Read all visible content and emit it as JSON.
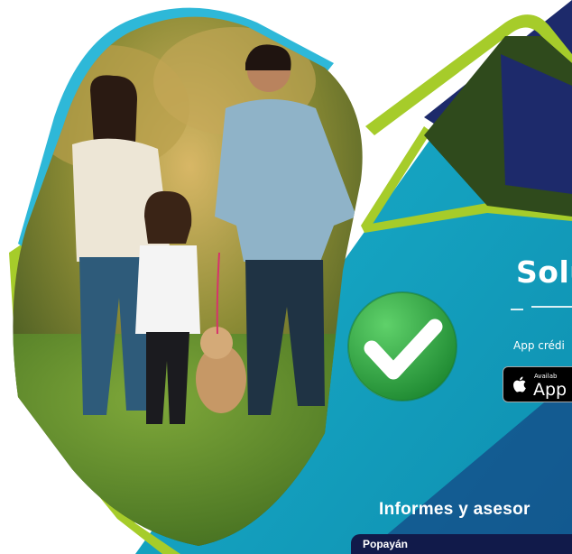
{
  "banner": {
    "headline": "Solu",
    "app_text": "App crédi",
    "store_badge": {
      "small_text": "Availab",
      "big_text": "App",
      "icon": "apple-icon"
    },
    "info_text": "Informes y asesor",
    "city": "Popayán",
    "check_icon": "check-icon"
  },
  "colors": {
    "navy": "#1d2a6b",
    "teal": "#15a6c2",
    "cyan_frame": "#2eb8d8",
    "lime_frame": "#a6cc2a",
    "check_green": "#2a9a3c",
    "city_bar": "#111a4a"
  }
}
